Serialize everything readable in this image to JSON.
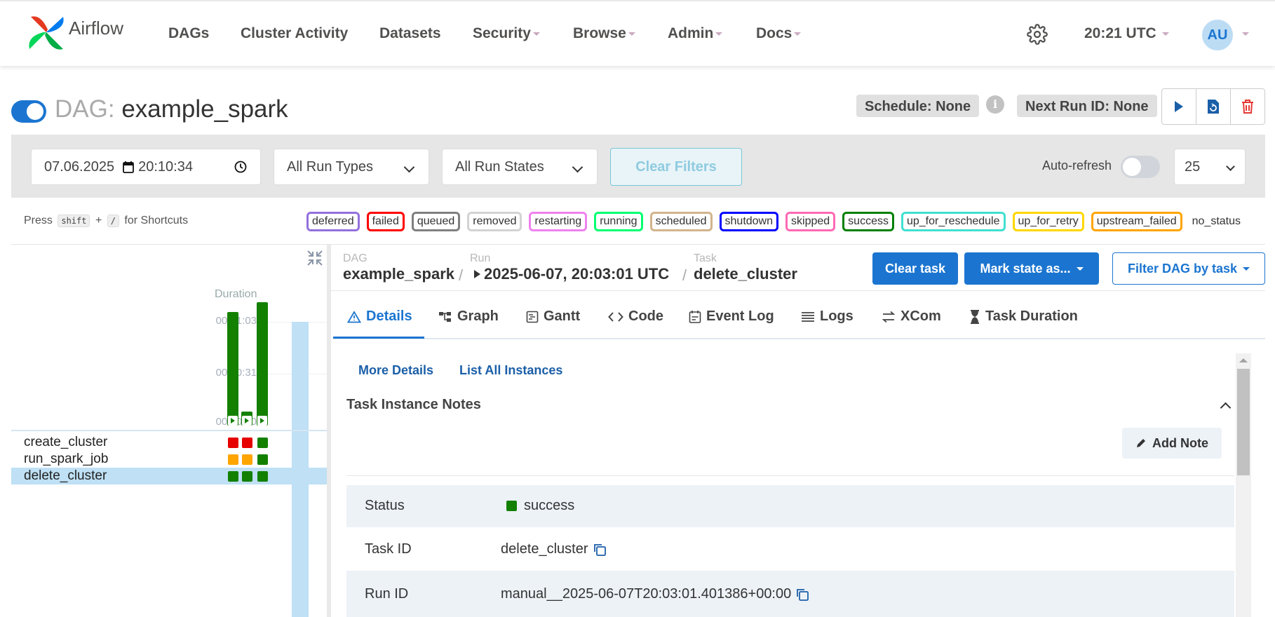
{
  "brand": {
    "name": "Airflow"
  },
  "nav": {
    "items": [
      {
        "label": "DAGs",
        "dropdown": false
      },
      {
        "label": "Cluster Activity",
        "dropdown": false
      },
      {
        "label": "Datasets",
        "dropdown": false
      },
      {
        "label": "Security",
        "dropdown": true
      },
      {
        "label": "Browse",
        "dropdown": true
      },
      {
        "label": "Admin",
        "dropdown": true
      },
      {
        "label": "Docs",
        "dropdown": true
      }
    ],
    "clock": "20:21 UTC",
    "avatar_initials": "AU"
  },
  "dag": {
    "prefix": "DAG:",
    "name": "example_spark",
    "paused": false,
    "schedule": "Schedule: None",
    "next_run": "Next Run ID: None"
  },
  "filters": {
    "date": "07.06.2025",
    "time": "20:10:34",
    "run_types": "All Run Types",
    "run_states": "All Run States",
    "clear_label": "Clear Filters",
    "auto_refresh_label": "Auto-refresh",
    "auto_refresh_on": false,
    "page_size": "25"
  },
  "shortcuts": {
    "press": "Press",
    "key1": "shift",
    "plus": "+",
    "key2": "/",
    "suffix": "for Shortcuts"
  },
  "legend": [
    {
      "label": "deferred",
      "color": "#9370db"
    },
    {
      "label": "failed",
      "color": "#ff0000"
    },
    {
      "label": "queued",
      "color": "#808080"
    },
    {
      "label": "removed",
      "color": "#d3d3d3"
    },
    {
      "label": "restarting",
      "color": "#ee82ee"
    },
    {
      "label": "running",
      "color": "#01ff70"
    },
    {
      "label": "scheduled",
      "color": "#d2b48c"
    },
    {
      "label": "shutdown",
      "color": "#0000ff"
    },
    {
      "label": "skipped",
      "color": "#ff69b4"
    },
    {
      "label": "success",
      "color": "#008000"
    },
    {
      "label": "up_for_reschedule",
      "color": "#40e0d0"
    },
    {
      "label": "up_for_retry",
      "color": "#ffd700"
    },
    {
      "label": "upstream_failed",
      "color": "#ffa500"
    },
    {
      "label": "no_status",
      "color": ""
    }
  ],
  "grid": {
    "duration_label": "Duration",
    "ticks": [
      "00:01:03",
      "00:00:31",
      "00:00:00"
    ],
    "runs": [
      {
        "duration_seconds": 58,
        "state": "success"
      },
      {
        "duration_seconds": 7,
        "state": "success"
      },
      {
        "duration_seconds": 63,
        "state": "success",
        "selected": true
      }
    ],
    "tasks": [
      {
        "name": "create_cluster",
        "states": [
          "failed",
          "failed",
          "success"
        ]
      },
      {
        "name": "run_spark_job",
        "states": [
          "upstream_failed",
          "upstream_failed",
          "success"
        ]
      },
      {
        "name": "delete_cluster",
        "states": [
          "success",
          "success",
          "success"
        ],
        "selected": true
      }
    ],
    "state_colors": {
      "success": "#138000",
      "failed": "#e60000",
      "upstream_failed": "#ffa500"
    }
  },
  "breadcrumb": {
    "dag_label": "DAG",
    "dag_value": "example_spark",
    "run_label": "Run",
    "run_value": "2025-06-07, 20:03:01 UTC",
    "task_label": "Task",
    "task_value": "delete_cluster",
    "sep": "/"
  },
  "actions": {
    "clear_task": "Clear task",
    "mark_state": "Mark state as...",
    "filter_dag": "Filter DAG by task"
  },
  "tabs": [
    {
      "label": "Details",
      "icon": "warning-triangle-icon",
      "active": true
    },
    {
      "label": "Graph",
      "icon": "graph-icon"
    },
    {
      "label": "Gantt",
      "icon": "gantt-icon"
    },
    {
      "label": "Code",
      "icon": "code-icon"
    },
    {
      "label": "Event Log",
      "icon": "event-log-icon"
    },
    {
      "label": "Logs",
      "icon": "logs-icon"
    },
    {
      "label": "XCom",
      "icon": "xcom-icon"
    },
    {
      "label": "Task Duration",
      "icon": "hourglass-icon"
    }
  ],
  "details": {
    "more_details": "More Details",
    "list_instances": "List All Instances",
    "notes_title": "Task Instance Notes",
    "add_note": "Add Note",
    "rows": [
      {
        "key": "Status",
        "value": "success",
        "status_color": "#138000"
      },
      {
        "key": "Task ID",
        "value": "delete_cluster",
        "copy": true
      },
      {
        "key": "Run ID",
        "value": "manual__2025-06-07T20:03:01.401386+00:00",
        "copy": true
      }
    ]
  }
}
